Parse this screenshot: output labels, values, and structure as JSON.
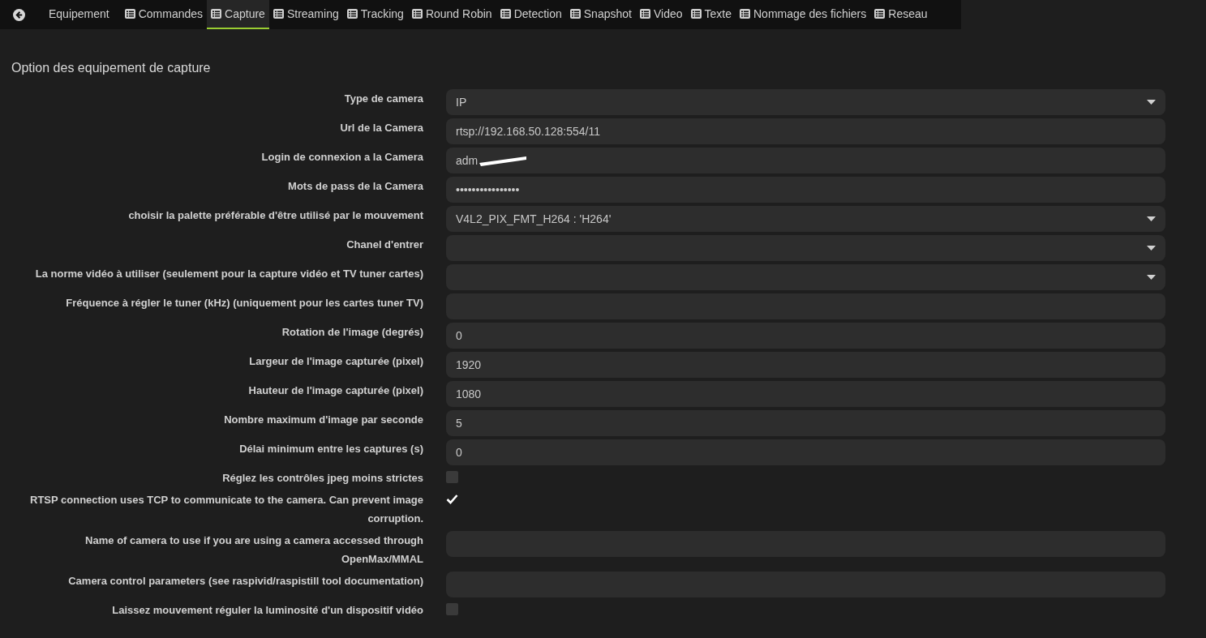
{
  "nav": {
    "back": true,
    "tabs": [
      {
        "label": "Equipement",
        "icon": false,
        "selected": false
      },
      {
        "label": "Commandes",
        "icon": true,
        "selected": false
      },
      {
        "label": "Capture",
        "icon": true,
        "selected": true
      },
      {
        "label": "Streaming",
        "icon": true,
        "selected": false
      },
      {
        "label": "Tracking",
        "icon": true,
        "selected": false
      },
      {
        "label": "Round Robin",
        "icon": true,
        "selected": false
      },
      {
        "label": "Detection",
        "icon": true,
        "selected": false
      },
      {
        "label": "Snapshot",
        "icon": true,
        "selected": false
      },
      {
        "label": "Video",
        "icon": true,
        "selected": false
      },
      {
        "label": "Texte",
        "icon": true,
        "selected": false
      },
      {
        "label": "Nommage des fichiers",
        "icon": true,
        "selected": false
      },
      {
        "label": "Reseau",
        "icon": true,
        "selected": false
      }
    ]
  },
  "section": {
    "title": "Option des equipement de capture",
    "rows": [
      {
        "label": "Type de camera",
        "kind": "select",
        "value": "IP"
      },
      {
        "label": "Url de la Camera",
        "kind": "text",
        "value": "rtsp://192.168.50.128:554/11"
      },
      {
        "label": "Login de connexion a la Camera",
        "kind": "text",
        "value": "adm",
        "redacted": true
      },
      {
        "label": "Mots de pass de la Camera",
        "kind": "password",
        "value": "••••••••••••••••"
      },
      {
        "label": "choisir la palette préférable d'être utilisé par le mouvement",
        "kind": "select",
        "value": "V4L2_PIX_FMT_H264 : 'H264'"
      },
      {
        "label": "Chanel d'entrer",
        "kind": "select"
      },
      {
        "label": "La norme vidéo à utiliser (seulement pour la capture vidéo et TV tuner cartes)",
        "kind": "select"
      },
      {
        "label": "Fréquence à régler le tuner (kHz) (uniquement pour les cartes tuner TV)",
        "kind": "text"
      },
      {
        "label": "Rotation de l'image (degrés)",
        "kind": "text",
        "value": "0"
      },
      {
        "label": "Largeur de l'image capturée (pixel)",
        "kind": "text",
        "value": "1920"
      },
      {
        "label": "Hauteur de l'image capturée (pixel)",
        "kind": "text",
        "value": "1080"
      },
      {
        "label": "Nombre maximum d'image par seconde",
        "kind": "text",
        "value": "5"
      },
      {
        "label": "Délai minimum entre les captures (s)",
        "kind": "text",
        "value": "0"
      },
      {
        "label": "Réglez les contrôles jpeg moins strictes",
        "kind": "checkbox",
        "checked": false
      },
      {
        "label": "RTSP connection uses TCP to communicate to the camera. Can prevent image corruption.",
        "kind": "checkbox",
        "checked": true
      },
      {
        "label": "Name of camera to use if you are using a camera accessed through OpenMax/MMAL",
        "kind": "text"
      },
      {
        "label": "Camera control parameters (see raspivid/raspistill tool documentation)",
        "kind": "text"
      },
      {
        "label": "Laissez mouvement réguler la luminosité d'un dispositif vidéo",
        "kind": "checkbox",
        "checked": false
      }
    ]
  }
}
